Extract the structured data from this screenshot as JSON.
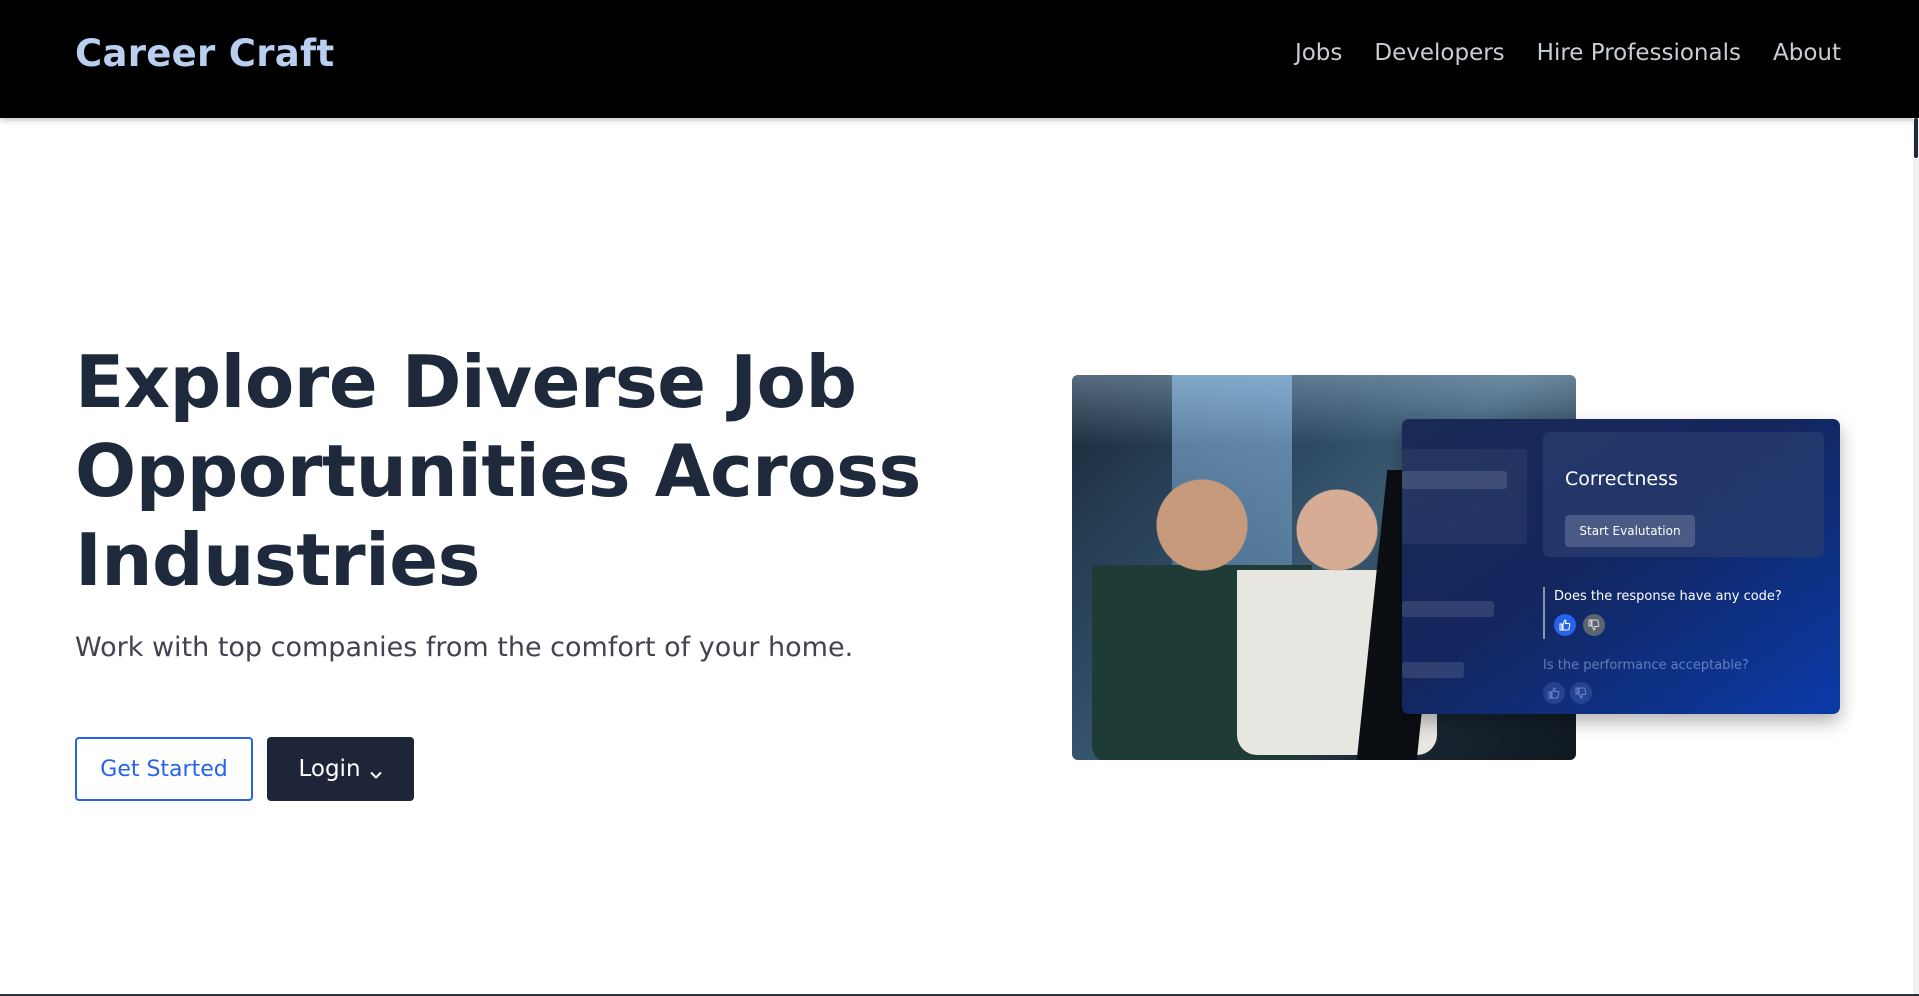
{
  "header": {
    "brand": "Career Craft",
    "nav": [
      "Jobs",
      "Developers",
      "Hire Professionals",
      "About"
    ]
  },
  "hero": {
    "title": "Explore Diverse Job Opportunities Across Industries",
    "subtitle": "Work with top companies from the comfort of your home.",
    "get_started_label": "Get Started",
    "login_label": "Login"
  },
  "evaluation_panel": {
    "card_title": "Correctness",
    "start_button": "Start Evalutation",
    "question_1": "Does the response have any code?",
    "question_2": "Is the performance acceptable?"
  },
  "icons": [
    "chevron-down-icon",
    "thumbs-up-icon",
    "thumbs-down-icon"
  ],
  "colors": {
    "header_bg": "#000000",
    "brand": "#b9cff0",
    "title": "#1e293b",
    "accent_blue": "#2563eb",
    "dark_button": "#1e2539"
  }
}
